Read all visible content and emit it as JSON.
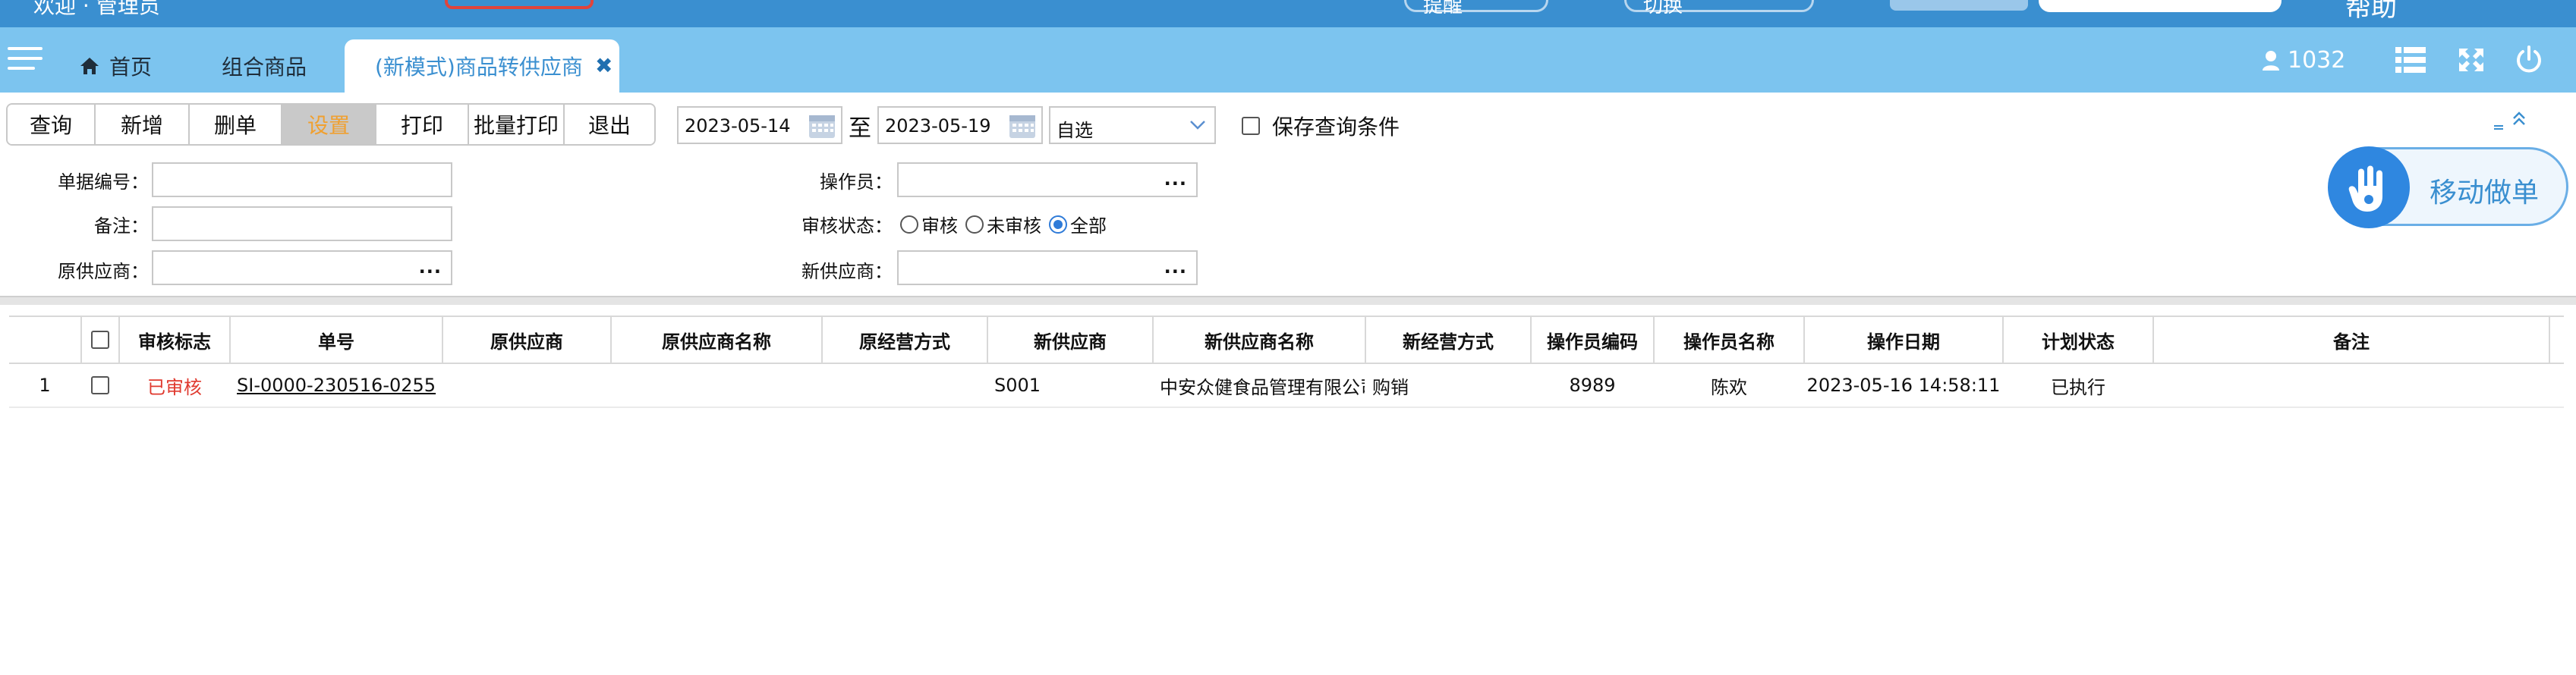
{
  "topstrip": {
    "left_text": "欢迎 · 管理员",
    "pill_1": "提醒",
    "pill_2": "切换",
    "right_text": "帮助"
  },
  "tabs": {
    "home": "首页",
    "combo": "组合商品",
    "active": "(新模式)商品转供应商",
    "close_glyph": "✖"
  },
  "user": {
    "id": "1032"
  },
  "toolbar": {
    "buttons": [
      "查询",
      "新增",
      "删单",
      "设置",
      "打印",
      "批量打印",
      "退出"
    ]
  },
  "date_range": {
    "from": "2023-05-14",
    "to_label": "至",
    "to": "2023-05-19",
    "preset": "自选"
  },
  "save_query": {
    "label": "保存查询条件"
  },
  "filters": {
    "bill_no_label": "单据编号：",
    "remark_label": "备注：",
    "orig_supplier_label": "原供应商：",
    "operator_label": "操作员：",
    "audit_label": "审核状态：",
    "new_supplier_label": "新供应商：",
    "dots": "...",
    "audit_options": [
      "审核",
      "未审核",
      "全部"
    ],
    "audit_selected": "全部"
  },
  "mobile_button": {
    "label": "移动做单"
  },
  "grid": {
    "columns": [
      "审核标志",
      "单号",
      "原供应商",
      "原供应商名称",
      "原经营方式",
      "新供应商",
      "新供应商名称",
      "新经营方式",
      "操作员编码",
      "操作员名称",
      "操作日期",
      "计划状态",
      "备注"
    ],
    "rows": [
      {
        "index": "1",
        "audit_flag": "已审核",
        "bill_no": "SI-0000-230516-0255",
        "orig_supplier": "",
        "orig_supplier_name": "",
        "orig_mode": "",
        "new_supplier": "S001",
        "new_supplier_name": "中安众健食品管理有限公司",
        "new_mode": "购销",
        "operator_code": "8989",
        "operator_name": "陈欢",
        "op_date": "2023-05-16 14:58:11",
        "plan_status": "已执行",
        "remark": ""
      }
    ]
  },
  "colors": {
    "header_blue": "#3a8fd0",
    "tabbar_blue": "#7cc4ef",
    "audited_red": "#e03a2f",
    "active_orange": "#f0a030"
  }
}
